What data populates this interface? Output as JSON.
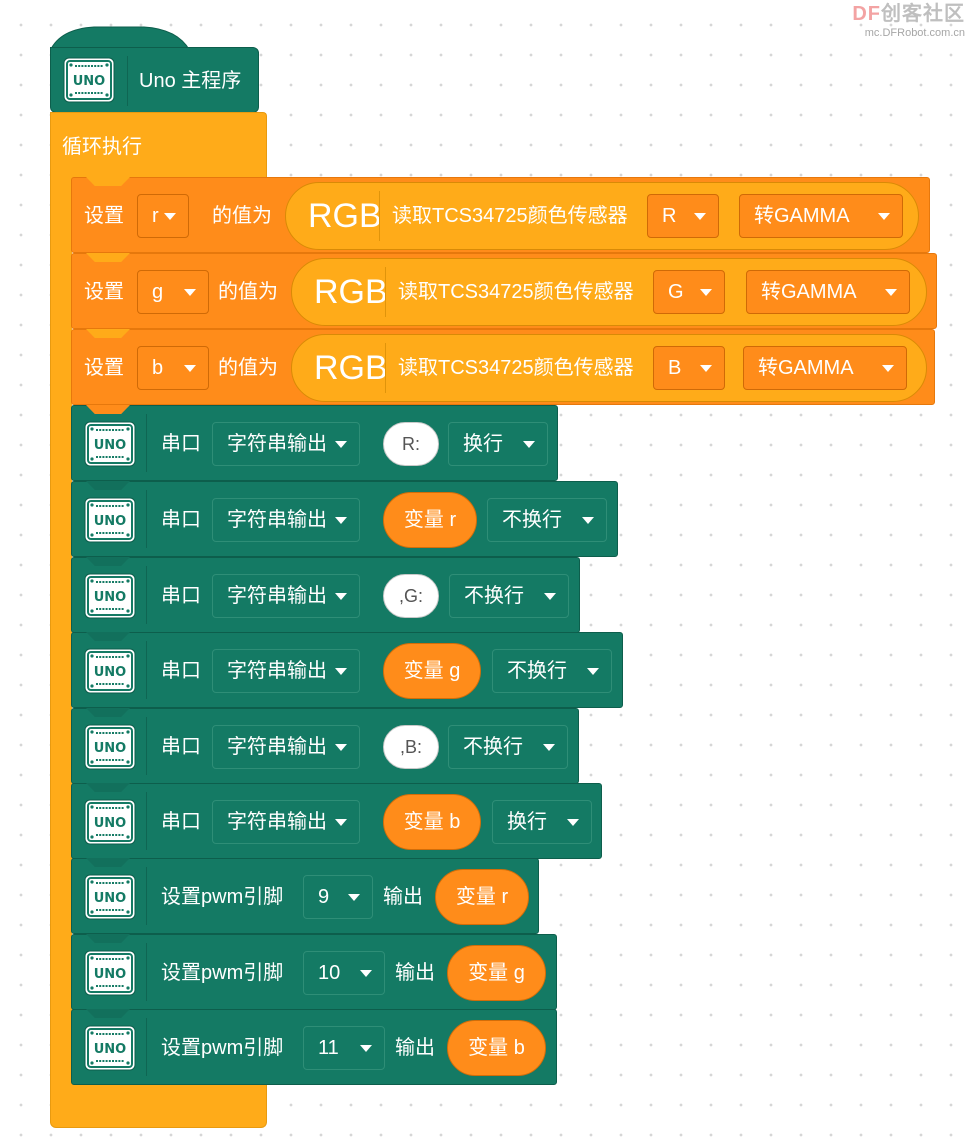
{
  "watermark": {
    "brand_df": "DF",
    "brand_rest": "创客社区",
    "url": "mc.DFRobot.com.cn"
  },
  "hat": {
    "icon_text": "UNO",
    "label": "Uno 主程序"
  },
  "loop": {
    "label": "循环执行"
  },
  "set_blocks": [
    {
      "set": "设置",
      "var": "r",
      "assign": "的值为",
      "rgb": "RGB",
      "read": "读取TCS34725颜色传感器",
      "channel": "R",
      "gamma": "转GAMMA"
    },
    {
      "set": "设置",
      "var": "g",
      "assign": "的值为",
      "rgb": "RGB",
      "read": "读取TCS34725颜色传感器",
      "channel": "G",
      "gamma": "转GAMMA"
    },
    {
      "set": "设置",
      "var": "b",
      "assign": "的值为",
      "rgb": "RGB",
      "read": "读取TCS34725颜色传感器",
      "channel": "B",
      "gamma": "转GAMMA"
    }
  ],
  "serial_blocks": [
    {
      "icon_text": "UNO",
      "label": "串口",
      "mode": "字符串输出",
      "value": "R:",
      "value_kind": "string",
      "newline": "换行"
    },
    {
      "icon_text": "UNO",
      "label": "串口",
      "mode": "字符串输出",
      "value": "变量 r",
      "value_kind": "variable",
      "newline": "不换行"
    },
    {
      "icon_text": "UNO",
      "label": "串口",
      "mode": "字符串输出",
      "value": ",G:",
      "value_kind": "string",
      "newline": "不换行"
    },
    {
      "icon_text": "UNO",
      "label": "串口",
      "mode": "字符串输出",
      "value": "变量 g",
      "value_kind": "variable",
      "newline": "不换行"
    },
    {
      "icon_text": "UNO",
      "label": "串口",
      "mode": "字符串输出",
      "value": ",B:",
      "value_kind": "string",
      "newline": "不换行"
    },
    {
      "icon_text": "UNO",
      "label": "串口",
      "mode": "字符串输出",
      "value": "变量 b",
      "value_kind": "variable",
      "newline": "换行"
    }
  ],
  "pwm_blocks": [
    {
      "icon_text": "UNO",
      "label": "设置pwm引脚",
      "pin": "9",
      "out": "输出",
      "value": "变量 r"
    },
    {
      "icon_text": "UNO",
      "label": "设置pwm引脚",
      "pin": "10",
      "out": "输出",
      "value": "变量 g"
    },
    {
      "icon_text": "UNO",
      "label": "设置pwm引脚",
      "pin": "11",
      "out": "输出",
      "value": "变量 b"
    }
  ],
  "colors": {
    "green": "#147a64",
    "orange": "#ff8c1a",
    "loop_orange": "#ffab19"
  }
}
